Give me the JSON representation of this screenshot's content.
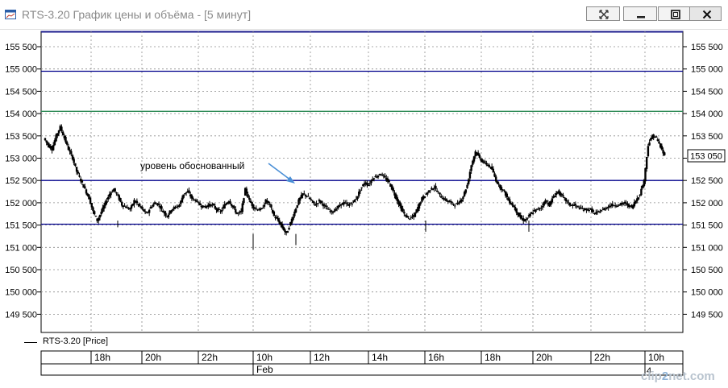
{
  "window": {
    "title": "RTS-3.20 График цены и объёма - [5 минут]",
    "icon": "chart-window-icon",
    "buttons": [
      {
        "name": "restore-down-button",
        "icon": "crossed-arrows-icon"
      },
      {
        "name": "minimize-button",
        "icon": "minimize-icon"
      },
      {
        "name": "maximize-button",
        "icon": "maximize-icon"
      },
      {
        "name": "close-button",
        "icon": "close-icon"
      }
    ]
  },
  "colors": {
    "candle": "#000000",
    "grid": "#8c8c8c",
    "level_blue": "#00008b",
    "level_green": "#2e8b57",
    "annotation_arrow": "#4a8fd6",
    "price_tag_border": "#000000"
  },
  "chart_data": {
    "type": "line",
    "instrument": "RTS-3.20",
    "series": [
      {
        "name": "RTS-3.20 [Price]"
      }
    ],
    "legend_label": "RTS-3.20 [Price]",
    "y_axis": {
      "ticks": [
        "155 500",
        "155 000",
        "154 500",
        "154 000",
        "153 500",
        "153 000",
        "152 500",
        "152 000",
        "151 500",
        "151 000",
        "150 500",
        "150 000",
        "149 500"
      ],
      "ylim": [
        149200,
        155900
      ],
      "grid": true
    },
    "x_axis": {
      "time_ticks": [
        "18h",
        "20h",
        "22h",
        "10h",
        "12h",
        "14h",
        "16h",
        "18h",
        "20h",
        "22h",
        "10h"
      ],
      "date_ticks": [
        "Feb",
        "4"
      ]
    },
    "horizontal_levels": [
      {
        "price": 154950,
        "color": "blue"
      },
      {
        "price": 154050,
        "color": "green"
      },
      {
        "price": 152500,
        "color": "blue"
      },
      {
        "price": 151520,
        "color": "blue"
      }
    ],
    "annotation": "уровень обоснованный",
    "last_price": "153 050",
    "price_path": [
      153450,
      153300,
      153200,
      153500,
      153700,
      153450,
      153200,
      153000,
      152700,
      152500,
      152300,
      152100,
      151800,
      151600,
      151800,
      152000,
      152200,
      152300,
      152150,
      151950,
      151900,
      151850,
      152050,
      151950,
      151850,
      151750,
      151900,
      152000,
      151950,
      151800,
      151700,
      151850,
      151900,
      151950,
      152200,
      152250,
      152100,
      152050,
      151950,
      151900,
      151950,
      151950,
      151850,
      151800,
      151950,
      152050,
      151900,
      151750,
      151800,
      152300,
      152050,
      151900,
      151850,
      151850,
      152050,
      151950,
      151700,
      151600,
      151450,
      151300,
      151550,
      151800,
      152050,
      152200,
      152150,
      152050,
      151950,
      152050,
      151950,
      151850,
      151800,
      151850,
      151950,
      152000,
      151950,
      152000,
      152100,
      152300,
      152450,
      152400,
      152550,
      152600,
      152650,
      152550,
      152450,
      152250,
      152050,
      151850,
      151700,
      151650,
      151700,
      151900,
      152100,
      152200,
      152300,
      152350,
      152200,
      152100,
      152050,
      152000,
      151950,
      152000,
      152150,
      152400,
      152850,
      153150,
      153000,
      152900,
      152850,
      152750,
      152500,
      152350,
      152250,
      152050,
      151950,
      151800,
      151650,
      151600,
      151700,
      151800,
      151850,
      151900,
      152050,
      151950,
      152150,
      152250,
      152150,
      152050,
      151950,
      151950,
      151900,
      151850,
      151850,
      151850,
      151750,
      151800,
      151850,
      151900,
      151950,
      151950,
      151950,
      152000,
      151950,
      151900,
      152050,
      152200,
      152500,
      153300,
      153500,
      153450,
      153250,
      153050
    ]
  }
}
